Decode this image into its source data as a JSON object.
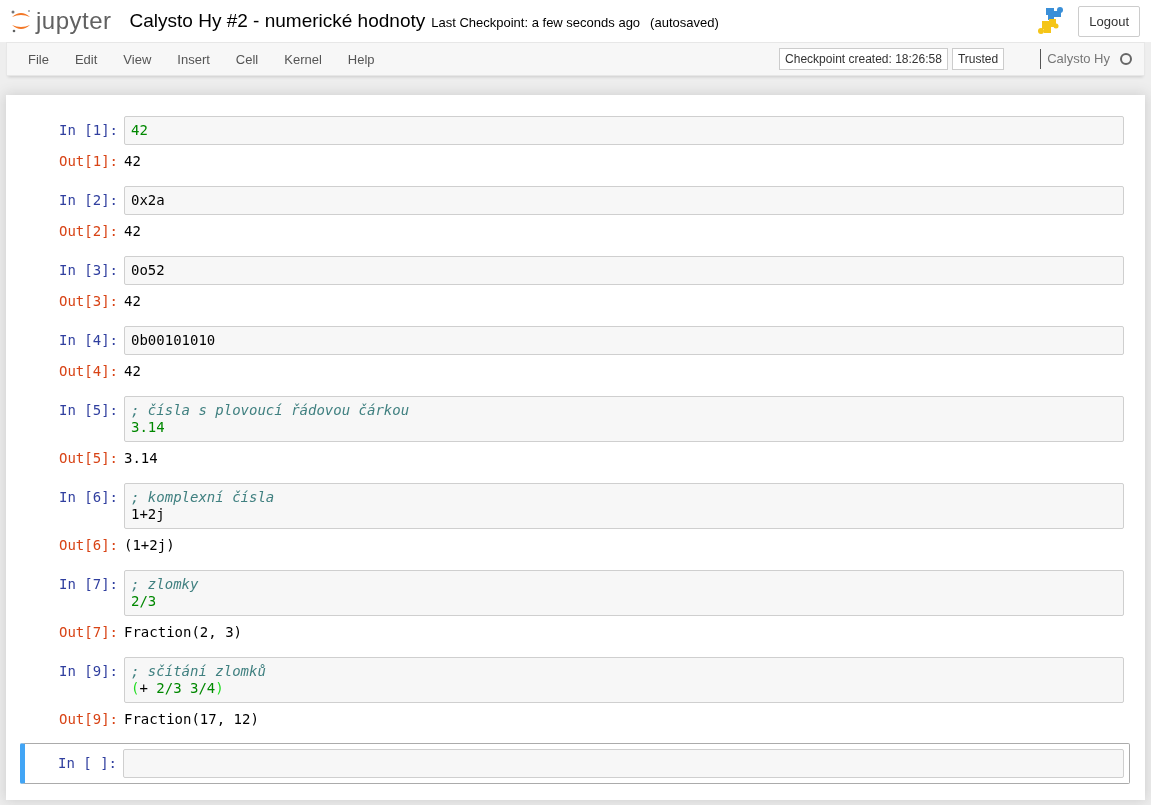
{
  "header": {
    "logo_text": "jupyter",
    "title": "Calysto Hy #2 - numerické hodnoty",
    "checkpoint": "Last Checkpoint: a few seconds ago",
    "autosave": "(autosaved)",
    "logout": "Logout"
  },
  "menu": [
    "File",
    "Edit",
    "View",
    "Insert",
    "Cell",
    "Kernel",
    "Help"
  ],
  "status": {
    "notification": "Checkpoint created: 18:26:58",
    "trusted": "Trusted",
    "kernel_name": "Calysto Hy",
    "kernel_busy": false
  },
  "cells": [
    {
      "in_prompt": "In [1]:",
      "selected": false,
      "lines": [
        [
          {
            "text": "42",
            "kind": "number"
          }
        ]
      ],
      "out_prompt": "Out[1]:",
      "output": "42"
    },
    {
      "in_prompt": "In [2]:",
      "selected": false,
      "lines": [
        [
          {
            "text": "0x2a",
            "kind": "plain"
          }
        ]
      ],
      "out_prompt": "Out[2]:",
      "output": "42"
    },
    {
      "in_prompt": "In [3]:",
      "selected": false,
      "lines": [
        [
          {
            "text": "0o52",
            "kind": "plain"
          }
        ]
      ],
      "out_prompt": "Out[3]:",
      "output": "42"
    },
    {
      "in_prompt": "In [4]:",
      "selected": false,
      "lines": [
        [
          {
            "text": "0b00101010",
            "kind": "plain"
          }
        ]
      ],
      "out_prompt": "Out[4]:",
      "output": "42"
    },
    {
      "in_prompt": "In [5]:",
      "selected": false,
      "lines": [
        [
          {
            "text": "; čísla s plovoucí řádovou čárkou",
            "kind": "comment"
          }
        ],
        [
          {
            "text": "3.14",
            "kind": "number"
          }
        ]
      ],
      "out_prompt": "Out[5]:",
      "output": "3.14"
    },
    {
      "in_prompt": "In [6]:",
      "selected": false,
      "lines": [
        [
          {
            "text": "; komplexní čísla",
            "kind": "comment"
          }
        ],
        [
          {
            "text": "1+2j",
            "kind": "plain"
          }
        ]
      ],
      "out_prompt": "Out[6]:",
      "output": "(1+2j)"
    },
    {
      "in_prompt": "In [7]:",
      "selected": false,
      "lines": [
        [
          {
            "text": "; zlomky",
            "kind": "comment"
          }
        ],
        [
          {
            "text": "2/3",
            "kind": "number"
          }
        ]
      ],
      "out_prompt": "Out[7]:",
      "output": "Fraction(2, 3)"
    },
    {
      "in_prompt": "In [9]:",
      "selected": false,
      "lines": [
        [
          {
            "text": "; sčítání zlomků",
            "kind": "comment"
          }
        ],
        [
          {
            "text": "(",
            "kind": "bracket"
          },
          {
            "text": "+ ",
            "kind": "plain"
          },
          {
            "text": "2/3 3/4",
            "kind": "number"
          },
          {
            "text": ")",
            "kind": "bracket"
          }
        ]
      ],
      "out_prompt": "Out[9]:",
      "output": "Fraction(17, 12)"
    },
    {
      "in_prompt": "In [ ]:",
      "selected": true
    }
  ]
}
